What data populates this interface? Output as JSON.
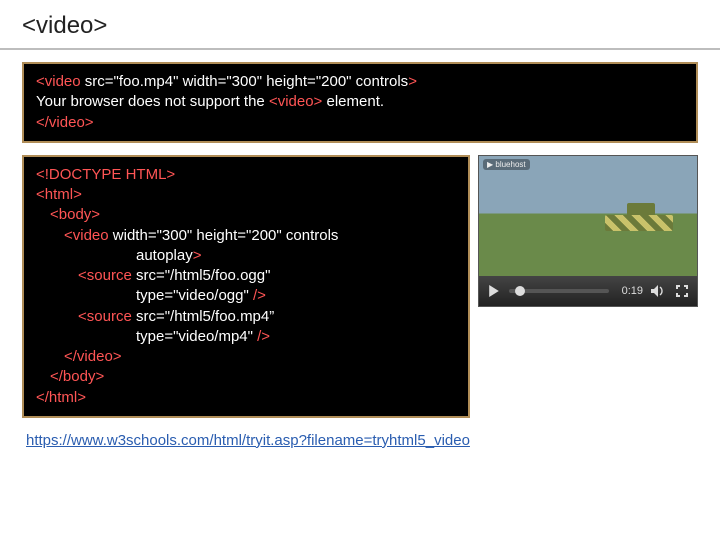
{
  "title": "<video>",
  "block1": {
    "l1": {
      "open": "<video ",
      "attrs": "src=\"foo.mp4\"  width=\"300\" height=\"200\" controls",
      "close": ">"
    },
    "l2": {
      "pre": "  Your browser does not support the ",
      "tag": "<video>",
      "post": " element."
    },
    "l3": "</video>"
  },
  "block2": {
    "l1": "<!DOCTYPE HTML>",
    "l2": "<html>",
    "l3": "<body>",
    "l4": {
      "open": "<video  ",
      "attrs": "width=\"300\" height=\"200\" controls"
    },
    "l5": {
      "attrs": "autoplay",
      "close": ">"
    },
    "l6": {
      "open": "<source ",
      "attrs": "src=\"/html5/foo.ogg\""
    },
    "l7": {
      "attrs": "type=\"video/ogg\" ",
      "close": "/>"
    },
    "l8": {
      "open": "<source ",
      "attrs": "src=\"/html5/foo.mp4”"
    },
    "l9": {
      "attrs": "type=\"video/mp4\" ",
      "close": "/>"
    },
    "l10": "</video>",
    "l11": "</body>",
    "l12": "</html>"
  },
  "player": {
    "brand": "▶ bluehost",
    "time": "0:19"
  },
  "link": "https://www.w3schools.com/html/tryit.asp?filename=tryhtml5_video"
}
